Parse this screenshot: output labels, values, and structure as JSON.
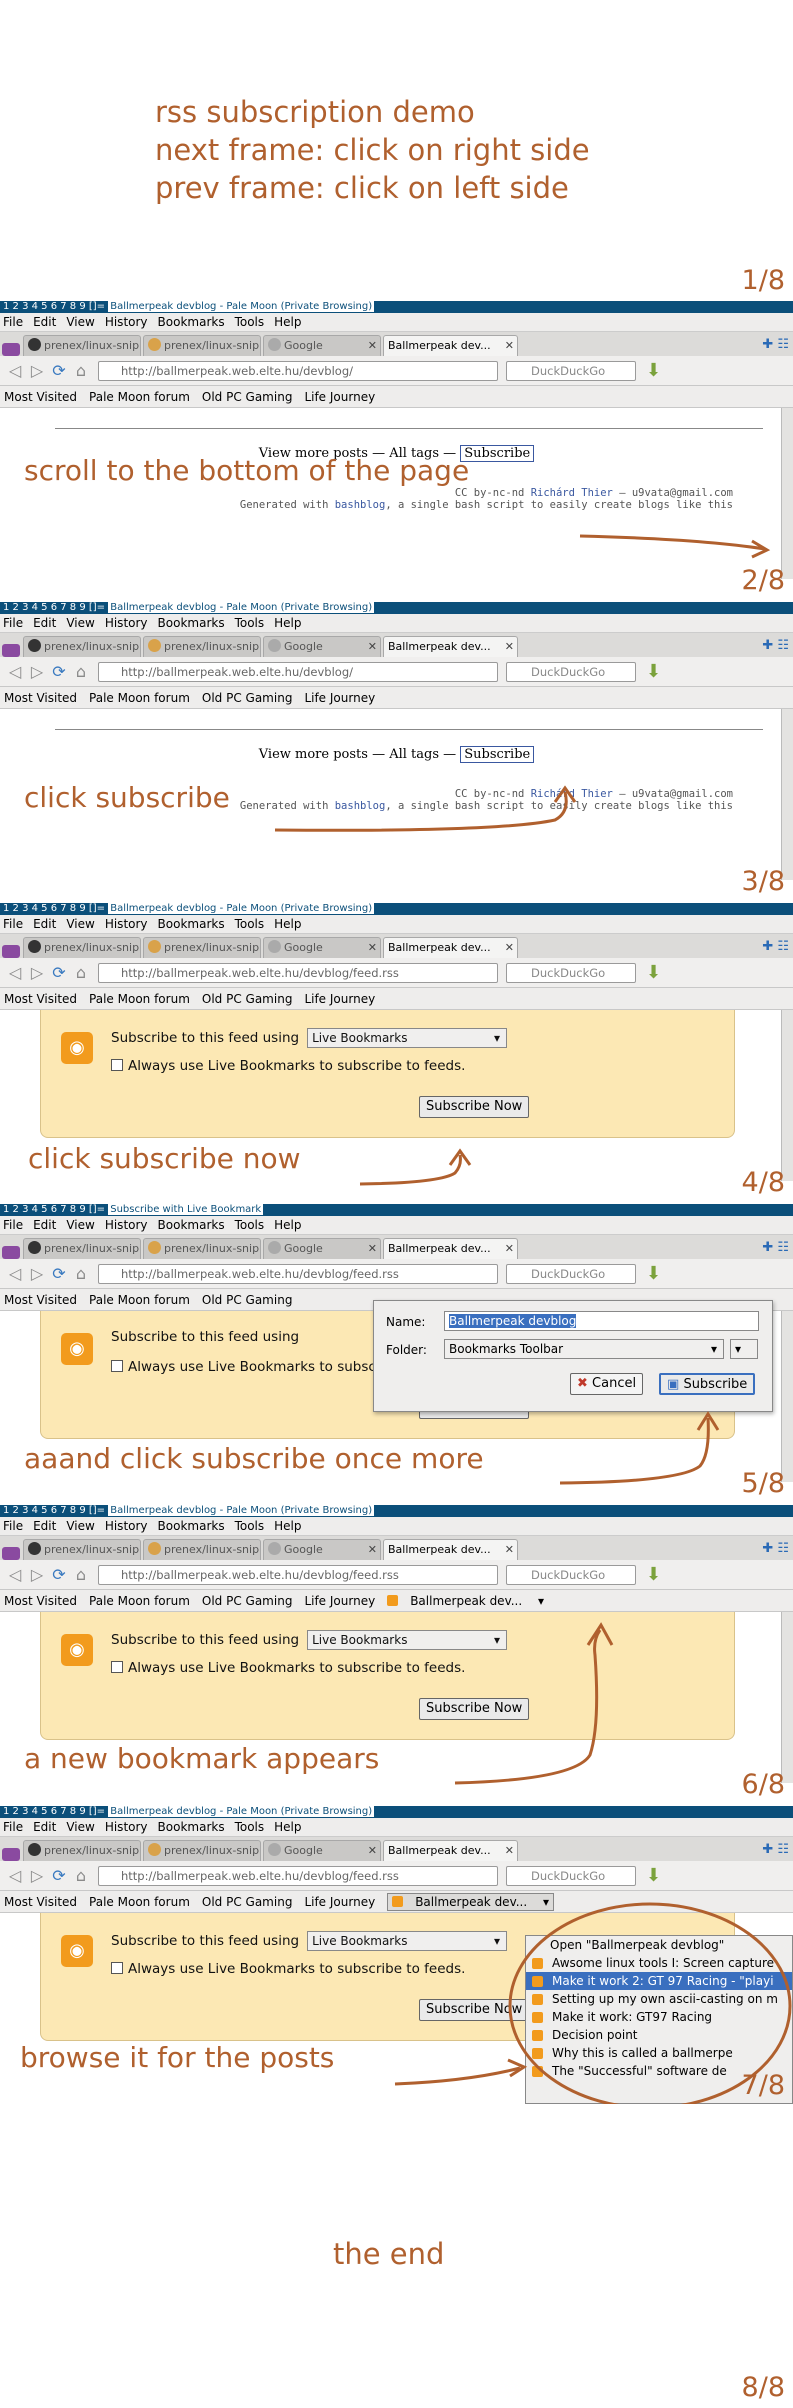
{
  "intro": [
    "rss subscription demo",
    "next frame: click on right side",
    "prev frame: click on left side"
  ],
  "frame_numbers": [
    "1/8",
    "2/8",
    "3/8",
    "4/8",
    "5/8",
    "6/8",
    "7/8",
    "8/8"
  ],
  "browser": {
    "title_prefix": "1 2 3 4 5 6 7 8 9 []=",
    "title": "Ballmerpeak devblog - Pale Moon (Private Browsing)",
    "title_bookmark": "Subscribe with Live Bookmark",
    "menus": [
      "File",
      "Edit",
      "View",
      "History",
      "Bookmarks",
      "Tools",
      "Help"
    ],
    "tabs": [
      "prenex/linux-snip...",
      "prenex/linux-snip...",
      "Google",
      "Ballmerpeak dev..."
    ],
    "url_blog": "http://ballmerpeak.web.elte.hu/devblog/",
    "url_feed": "http://ballmerpeak.web.elte.hu/devblog/feed.rss",
    "search_placeholder": "DuckDuckGo",
    "bookmarks": [
      "Most Visited",
      "Pale Moon forum",
      "Old PC Gaming",
      "Life Journey"
    ],
    "new_bookmark": "Ballmerpeak dev..."
  },
  "blog": {
    "more": "View more posts",
    "sep": " — ",
    "tags": "All tags",
    "subscribe": "Subscribe",
    "license": "CC by-nc-nd",
    "author": "Richárd Thier",
    "email": "u9vata@gmail.com",
    "gen1": "Generated with",
    "bashblog": "bashblog",
    "gen2": ", a single bash script to easily create blogs like this"
  },
  "feed": {
    "using": "Subscribe to this feed using",
    "reader": "Live Bookmarks",
    "always": "Always use Live Bookmarks to subscribe to feeds.",
    "subscribe_now": "Subscribe Now"
  },
  "dialog": {
    "name_label": "Name:",
    "name_value": "Ballmerpeak devblog",
    "folder_label": "Folder:",
    "folder_value": "Bookmarks Toolbar",
    "cancel": "Cancel",
    "subscribe": "Subscribe"
  },
  "livemenu": {
    "open": "Open \"Ballmerpeak devblog\"",
    "items": [
      "Awsome linux tools I: Screen capture",
      "Make it work 2: GT 97 Racing - \"playi",
      "Setting up my own ascii-casting on m",
      "Make it work: GT97 Racing",
      "Decision point",
      "Why this is called a ballmerpe",
      "The \"Successful\" software de"
    ]
  },
  "captions": {
    "scroll": "scroll to the bottom of the page",
    "click_subscribe": "click subscribe",
    "click_subscribe_now": "click subscribe now",
    "once_more": "aaand click subscribe once more",
    "new_bookmark": "a new bookmark appears",
    "browse": "browse it for the posts",
    "end": "the end"
  },
  "colors": {
    "annotation": "#b0602e",
    "titlebar": "#0b4f7a",
    "feedbox": "#fce8b4"
  }
}
